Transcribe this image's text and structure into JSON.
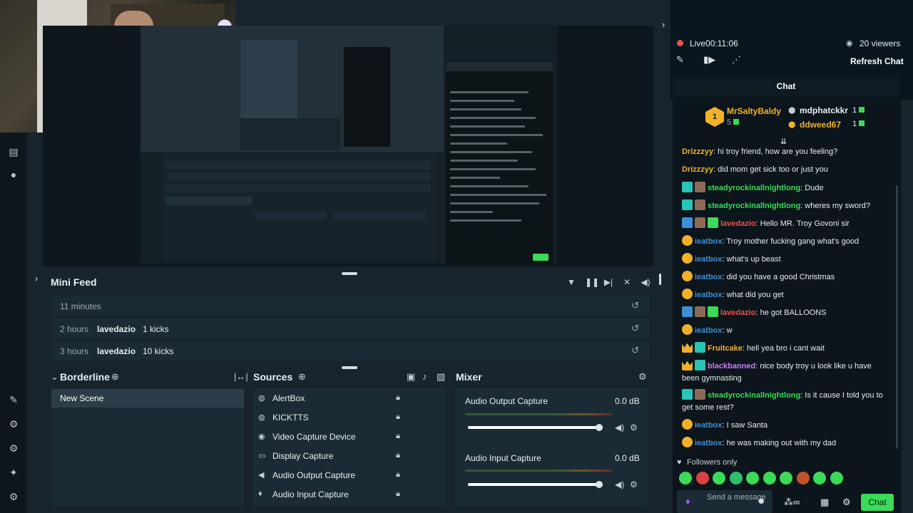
{
  "stream": {
    "live_label": "Live",
    "live_time": "00:11:06",
    "viewers": "20 viewers",
    "refresh_label": "Refresh Chat",
    "chat_title": "Chat"
  },
  "top_supporters": {
    "first": {
      "name": "MrSaltyBaldy",
      "value": "5"
    },
    "second": {
      "name": "mdphatckkr",
      "value": "1"
    },
    "third": {
      "name": "ddweed67",
      "value": "1"
    }
  },
  "chat_messages": [
    {
      "user": "Drizzzyy",
      "text": ": hi troy friend, how are you feeling?",
      "color": "#f2b127",
      "badges": []
    },
    {
      "user": "Drizzzyy",
      "text": ": did mom get sick too or just you",
      "color": "#f2b127",
      "badges": []
    },
    {
      "user": "steadyrockinallnightlong",
      "text": ": Dude",
      "color": "#3adb58",
      "badges": [
        "teal",
        "brown"
      ]
    },
    {
      "user": "steadyrockinallnightlong",
      "text": ": wheres my sword?",
      "color": "#3adb58",
      "badges": [
        "teal",
        "brown"
      ]
    },
    {
      "user": "lavedazio",
      "text": ": Hello MR. Troy Govoni sir",
      "color": "#f04d4d",
      "badges": [
        "blue",
        "brown",
        "mint"
      ]
    },
    {
      "user": "ieatbox",
      "text": ": Troy mother fucking gang what's good",
      "color": "#3d8fd8",
      "badges": [
        "gold"
      ]
    },
    {
      "user": "ieatbox",
      "text": ": what's up beast",
      "color": "#3d8fd8",
      "badges": [
        "gold"
      ]
    },
    {
      "user": "ieatbox",
      "text": ": did you have a good Christmas",
      "color": "#3d8fd8",
      "badges": [
        "gold"
      ]
    },
    {
      "user": "ieatbox",
      "text": ": what did you get",
      "color": "#3d8fd8",
      "badges": [
        "gold"
      ]
    },
    {
      "user": "lavedazio",
      "text": ": he got BALLOONS",
      "color": "#f04d4d",
      "badges": [
        "blue",
        "brown",
        "mint"
      ]
    },
    {
      "user": "ieatbox",
      "text": ": w",
      "color": "#3d8fd8",
      "badges": [
        "gold"
      ]
    },
    {
      "user": "Fruitcake",
      "text": ": hell yea bro i cant wait",
      "color": "#f2b127",
      "badges": [
        "crown",
        "teal"
      ]
    },
    {
      "user": "blackbanned",
      "text": ": nice body troy u look like u have been gymnasting",
      "color": "#c87cf5",
      "badges": [
        "crown",
        "teal"
      ]
    },
    {
      "user": "steadyrockinallnightlong",
      "text": ": Is it cause I told you to get some rest?",
      "color": "#3adb58",
      "badges": [
        "teal",
        "brown"
      ]
    },
    {
      "user": "ieatbox",
      "text": ": I saw Santa",
      "color": "#3d8fd8",
      "badges": [
        "gold"
      ]
    },
    {
      "user": "ieatbox",
      "text": ": he was making out with my dad",
      "color": "#3d8fd8",
      "badges": [
        "gold"
      ]
    }
  ],
  "chat_footer": {
    "followers_only": "Followers only",
    "input_placeholder": "Send a message",
    "chat_button": "Chat"
  },
  "mini_feed": {
    "title": "Mini Feed",
    "rows": [
      {
        "time": "11 minutes",
        "user": "",
        "message": ""
      },
      {
        "time": "2 hours",
        "user": "lavedazio",
        "message": "1 kicks"
      },
      {
        "time": "3 hours",
        "user": "lavedazio",
        "message": "10 kicks"
      }
    ]
  },
  "scenes": {
    "title": "Borderline",
    "items": [
      "New Scene"
    ]
  },
  "sources": {
    "title": "Sources",
    "items": [
      {
        "label": "AlertBox",
        "icon": "globe-icon"
      },
      {
        "label": "KICKTTS",
        "icon": "globe-icon"
      },
      {
        "label": "Video Capture Device",
        "icon": "camera-icon"
      },
      {
        "label": "Display Capture",
        "icon": "monitor-icon"
      },
      {
        "label": "Audio Output Capture",
        "icon": "speaker-icon"
      },
      {
        "label": "Audio Input Capture",
        "icon": "microphone-icon"
      }
    ]
  },
  "mixer": {
    "title": "Mixer",
    "channels": [
      {
        "name": "Audio Output Capture",
        "db": "0.0 dB",
        "volume": 1.0
      },
      {
        "name": "Audio Input Capture",
        "db": "0.0 dB",
        "volume": 1.0
      }
    ]
  },
  "colors": {
    "accent": "#3adb58",
    "live": "#f04d4d",
    "gold": "#f2b127"
  }
}
